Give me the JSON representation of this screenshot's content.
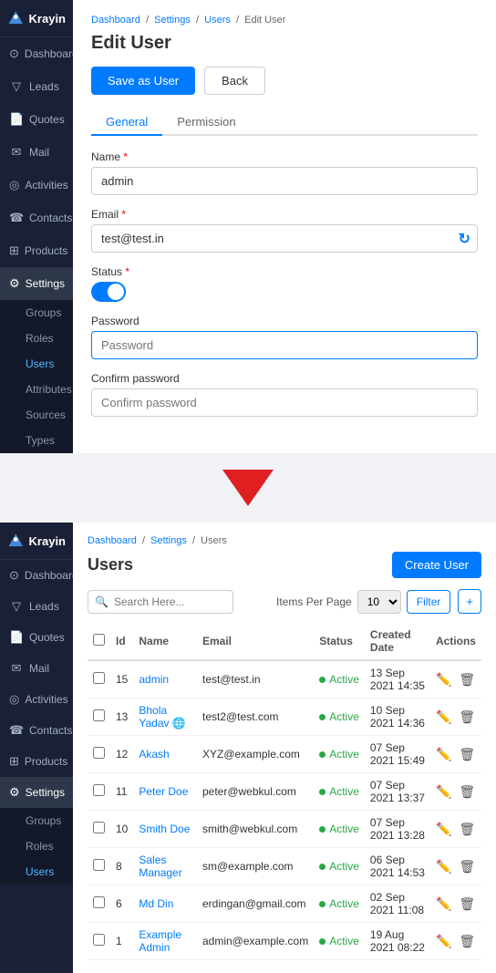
{
  "app": {
    "name": "Krayin"
  },
  "sidebar_top": {
    "items": [
      {
        "id": "dashboard",
        "label": "Dashboard",
        "icon": "⊙"
      },
      {
        "id": "leads",
        "label": "Leads",
        "icon": "⊿"
      },
      {
        "id": "quotes",
        "label": "Quotes",
        "icon": "🗒"
      },
      {
        "id": "mail",
        "label": "Mail",
        "icon": "✉"
      },
      {
        "id": "activities",
        "label": "Activities",
        "icon": "◎"
      },
      {
        "id": "contacts",
        "label": "Contacts",
        "icon": "☎"
      },
      {
        "id": "products",
        "label": "Products",
        "icon": "⊞"
      },
      {
        "id": "settings",
        "label": "Settings",
        "icon": "⚙",
        "active": true
      }
    ],
    "sub_items": [
      {
        "id": "groups",
        "label": "Groups"
      },
      {
        "id": "roles",
        "label": "Roles"
      },
      {
        "id": "users",
        "label": "Users",
        "active": true
      },
      {
        "id": "attributes",
        "label": "Attributes"
      },
      {
        "id": "sources",
        "label": "Sources"
      },
      {
        "id": "types",
        "label": "Types"
      }
    ]
  },
  "edit_user": {
    "breadcrumb": [
      "Dashboard",
      "Settings",
      "Users",
      "Edit User"
    ],
    "title": "Edit User",
    "btn_save": "Save as User",
    "btn_back": "Back",
    "tabs": [
      "General",
      "Permission"
    ],
    "active_tab": "General",
    "fields": {
      "name_label": "Name",
      "name_value": "admin",
      "email_label": "Email",
      "email_value": "test@test.in",
      "status_label": "Status",
      "password_label": "Password",
      "password_placeholder": "Password",
      "confirm_label": "Confirm password",
      "confirm_placeholder": "Confirm password"
    }
  },
  "sidebar_bottom": {
    "items": [
      {
        "id": "dashboard",
        "label": "Dashboard",
        "icon": "⊙"
      },
      {
        "id": "leads",
        "label": "Leads",
        "icon": "⊿"
      },
      {
        "id": "quotes",
        "label": "Quotes",
        "icon": "🗒"
      },
      {
        "id": "mail",
        "label": "Mail",
        "icon": "✉"
      },
      {
        "id": "activities",
        "label": "Activities",
        "icon": "◎"
      },
      {
        "id": "contacts",
        "label": "Contacts",
        "icon": "☎"
      },
      {
        "id": "products",
        "label": "Products",
        "icon": "⊞"
      },
      {
        "id": "settings",
        "label": "Settings",
        "icon": "⚙",
        "active": true
      }
    ],
    "sub_items": [
      {
        "id": "groups",
        "label": "Groups"
      },
      {
        "id": "roles",
        "label": "Roles"
      },
      {
        "id": "users",
        "label": "Users",
        "active": true
      }
    ]
  },
  "users_list": {
    "breadcrumb": [
      "Dashboard",
      "Settings",
      "Users"
    ],
    "title": "Users",
    "btn_create": "Create User",
    "search_placeholder": "Search Here...",
    "items_per_page_label": "Items Per Page",
    "items_per_page_value": "10",
    "btn_filter": "Filter",
    "columns": [
      "",
      "Id",
      "Name",
      "Email",
      "Status",
      "Created Date",
      "Actions"
    ],
    "rows": [
      {
        "id": "15",
        "name": "admin",
        "email": "test@test.in",
        "status": "Active",
        "created": "13 Sep 2021 14:35"
      },
      {
        "id": "13",
        "name": "Bhola Yadav 🌐",
        "email": "test2@test.com",
        "status": "Active",
        "created": "10 Sep 2021 14:36"
      },
      {
        "id": "12",
        "name": "Akash",
        "email": "XYZ@example.com",
        "status": "Active",
        "created": "07 Sep 2021 15:49"
      },
      {
        "id": "11",
        "name": "Peter Doe",
        "email": "peter@webkul.com",
        "status": "Active",
        "created": "07 Sep 2021 13:37"
      },
      {
        "id": "10",
        "name": "Smith Doe",
        "email": "smith@webkul.com",
        "status": "Active",
        "created": "07 Sep 2021 13:28"
      },
      {
        "id": "8",
        "name": "Sales Manager",
        "email": "sm@example.com",
        "status": "Active",
        "created": "06 Sep 2021 14:53"
      },
      {
        "id": "6",
        "name": "Md Din",
        "email": "erdingan@gmail.com",
        "status": "Active",
        "created": "02 Sep 2021 11:08"
      },
      {
        "id": "1",
        "name": "Example Admin",
        "email": "admin@example.com",
        "status": "Active",
        "created": "19 Aug 2021 08:22"
      }
    ]
  }
}
